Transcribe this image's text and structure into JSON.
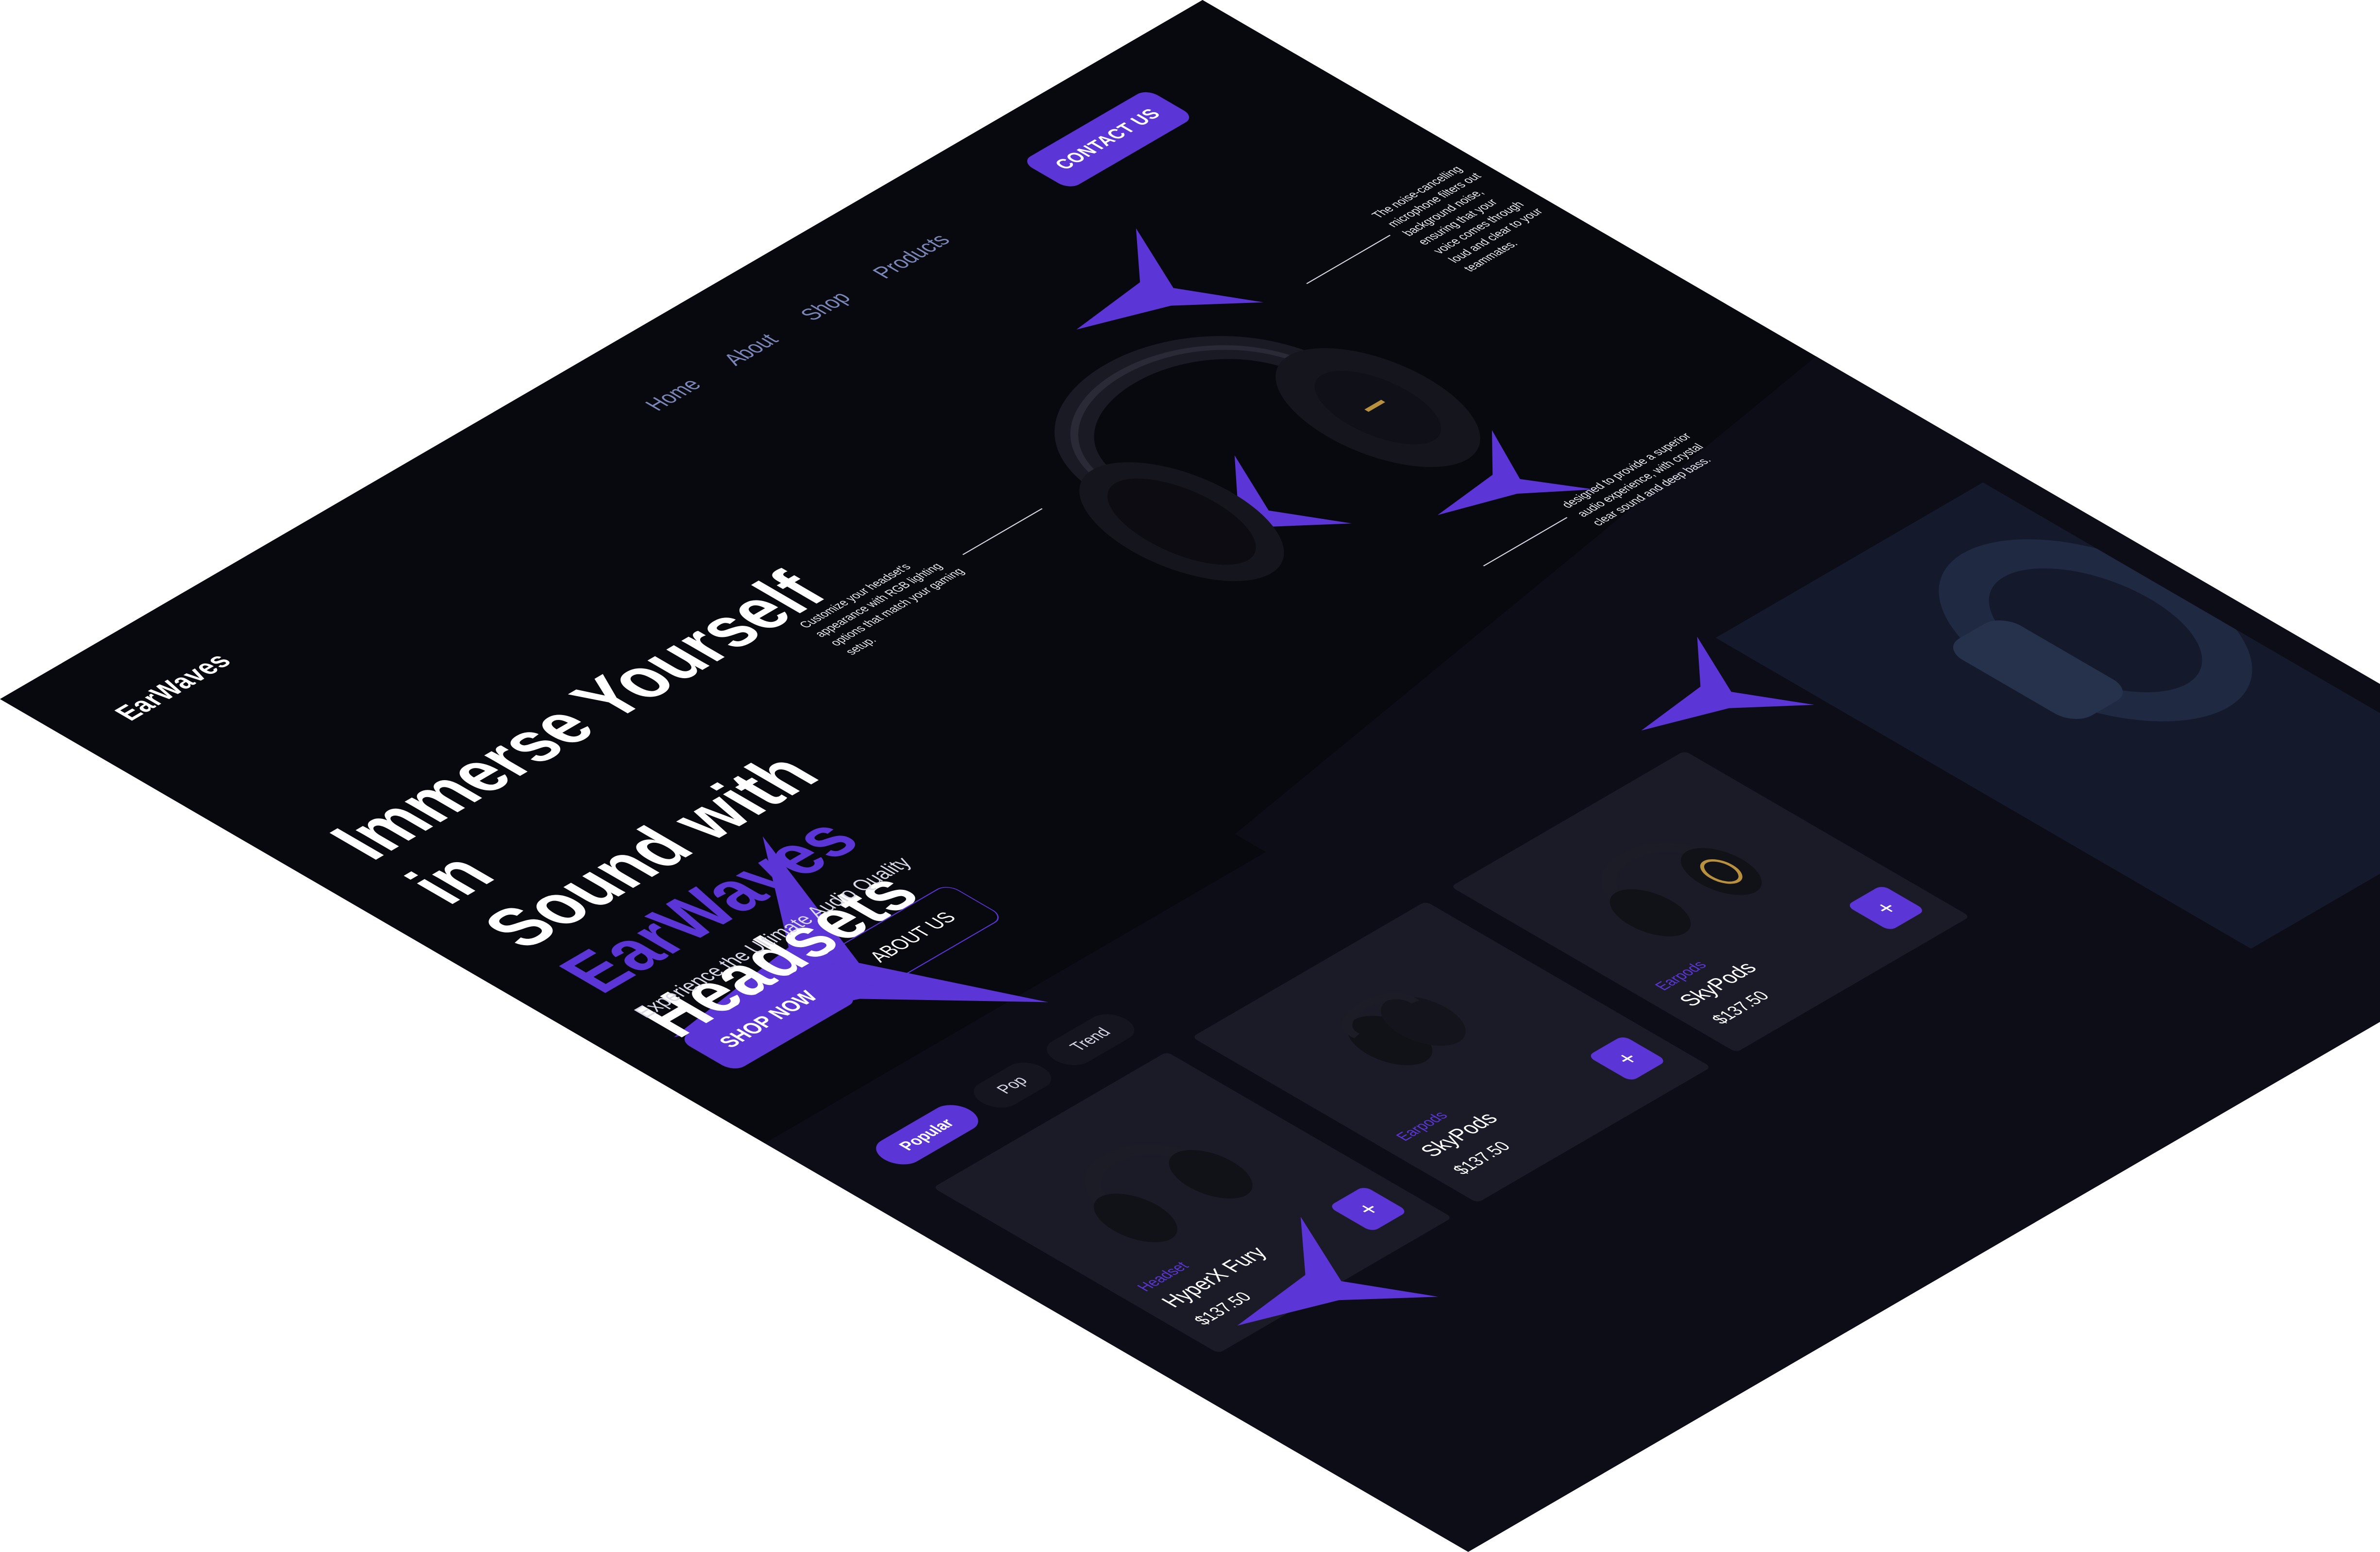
{
  "brand": {
    "logo": "EarWaves"
  },
  "nav": {
    "items": [
      "Home",
      "About",
      "Shop",
      "Products"
    ],
    "contact_label": "CONTACT US"
  },
  "hero": {
    "headline_line1": "Immerse Yourself in",
    "headline_line2": "Sound with",
    "headline_accent": "EarWaves",
    "headline_tail": "Headsets",
    "subline": "Experience the Ultimate Audio Quality",
    "shop_label": "SHOP NOW",
    "about_label": "ABOUT US",
    "callouts": [
      "Customize your headset's appearance with RGB lighting options that match your gaming setup.",
      "The noise-cancelling microphone filters out background noise, ensuring that your voice comes through loud and clear to your teammates.",
      "designed to provide a superior audio experience, with crystal clear sound and deep bass."
    ]
  },
  "filters": [
    "Popular",
    "Pop",
    "Trend"
  ],
  "products": [
    {
      "category": "Headset",
      "name": "HyperX Fury",
      "price": "$137.50"
    },
    {
      "category": "Earpods",
      "name": "SkyPods",
      "price": "$137.50"
    },
    {
      "category": "Earpods",
      "name": "SkyPods",
      "price": "$137.50"
    }
  ],
  "theme": {
    "accent": "#5b35d5",
    "bg": "#07070d",
    "card": "#1b1b27",
    "nav_text": "#7a87b8"
  },
  "icons": {
    "add": "plus-icon"
  }
}
